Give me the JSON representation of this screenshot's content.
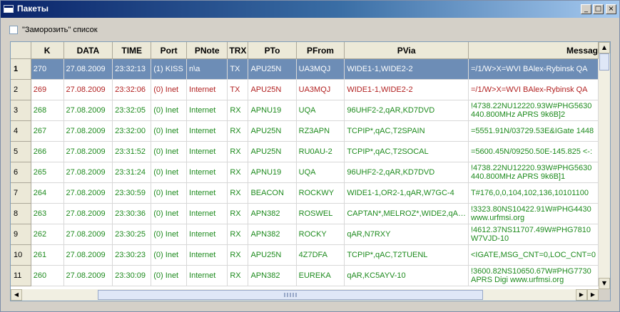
{
  "window": {
    "title": "Пакеты",
    "min_label": "_",
    "max_label": "□",
    "close_label": "×"
  },
  "freeze_checkbox": {
    "label": "\"Заморозить\" список",
    "checked": false
  },
  "colors": {
    "rx": "#1e8b1e",
    "tx_recent": "#b22222",
    "selected_bg": "#6d8db6",
    "selected_text": "#ffffff"
  },
  "table": {
    "columns": [
      "K",
      "DATA",
      "TIME",
      "Port",
      "PNote",
      "TRX",
      "PTo",
      "PFrom",
      "PVia",
      "Messag"
    ],
    "rows": [
      {
        "n": "1",
        "k": "270",
        "date": "27.08.2009",
        "time": "23:32:13",
        "port": "(1) KISS",
        "pnote": "n\\a",
        "trx": "TX",
        "pto": "APU25N",
        "pfrom": "UA3MQJ",
        "pvia": "WIDE1-1,WIDE2-2",
        "msg": "=/1/W>X=WVI  BAlex-Rybinsk QA",
        "color": "selected"
      },
      {
        "n": "2",
        "k": "269",
        "date": "27.08.2009",
        "time": "23:32:06",
        "port": "(0) Inet",
        "pnote": "Internet",
        "trx": "TX",
        "pto": "APU25N",
        "pfrom": "UA3MQJ",
        "pvia": "WIDE1-1,WIDE2-2",
        "msg": "=/1/W>X=WVI  BAlex-Rybinsk QA",
        "color": "tx"
      },
      {
        "n": "3",
        "k": "268",
        "date": "27.08.2009",
        "time": "23:32:05",
        "port": "(0) Inet",
        "pnote": "Internet",
        "trx": "RX",
        "pto": "APNU19",
        "pfrom": "UQA",
        "pvia": "96UHF2-2,qAR,KD7DVD",
        "msg": "!4738.22NU12220.93W#PHG5630 440.800MHz APRS 9k6B]2",
        "color": "rx"
      },
      {
        "n": "4",
        "k": "267",
        "date": "27.08.2009",
        "time": "23:32:00",
        "port": "(0) Inet",
        "pnote": "Internet",
        "trx": "RX",
        "pto": "APU25N",
        "pfrom": "RZ3APN",
        "pvia": "TCPIP*,qAC,T2SPAIN",
        "msg": "=5551.91N/03729.53E&IGate 1448",
        "color": "rx"
      },
      {
        "n": "5",
        "k": "266",
        "date": "27.08.2009",
        "time": "23:31:52",
        "port": "(0) Inet",
        "pnote": "Internet",
        "trx": "RX",
        "pto": "APU25N",
        "pfrom": "RU0AU-2",
        "pvia": "TCPIP*,qAC,T2SOCAL",
        "msg": "=5600.45N/09250.50E-145.825 <-:",
        "color": "rx"
      },
      {
        "n": "6",
        "k": "265",
        "date": "27.08.2009",
        "time": "23:31:24",
        "port": "(0) Inet",
        "pnote": "Internet",
        "trx": "RX",
        "pto": "APNU19",
        "pfrom": "UQA",
        "pvia": "96UHF2-2,qAR,KD7DVD",
        "msg": "!4738.22NU12220.93W#PHG5630 440.800MHz APRS 9k6B]1",
        "color": "rx"
      },
      {
        "n": "7",
        "k": "264",
        "date": "27.08.2009",
        "time": "23:30:59",
        "port": "(0) Inet",
        "pnote": "Internet",
        "trx": "RX",
        "pto": "BEACON",
        "pfrom": "ROCKWY",
        "pvia": "WIDE1-1,OR2-1,qAR,W7GC-4",
        "msg": "T#176,0,0,104,102,136,10101100",
        "color": "rx"
      },
      {
        "n": "8",
        "k": "263",
        "date": "27.08.2009",
        "time": "23:30:36",
        "port": "(0) Inet",
        "pnote": "Internet",
        "trx": "RX",
        "pto": "APN382",
        "pfrom": "ROSWEL",
        "pvia": "CAPTAN*,MELROZ*,WIDE2,qA…",
        "msg": "!3323.80NS10422.91W#PHG4430 www.urfmsi.org",
        "color": "rx"
      },
      {
        "n": "9",
        "k": "262",
        "date": "27.08.2009",
        "time": "23:30:25",
        "port": "(0) Inet",
        "pnote": "Internet",
        "trx": "RX",
        "pto": "APN382",
        "pfrom": "ROCKY",
        "pvia": "qAR,N7RXY",
        "msg": "!4612.37NS11707.49W#PHG7810 W7VJD-10",
        "color": "rx"
      },
      {
        "n": "10",
        "k": "261",
        "date": "27.08.2009",
        "time": "23:30:23",
        "port": "(0) Inet",
        "pnote": "Internet",
        "trx": "RX",
        "pto": "APU25N",
        "pfrom": "4Z7DFA",
        "pvia": "TCPIP*,qAC,T2TUENL",
        "msg": "<IGATE,MSG_CNT=0,LOC_CNT=0",
        "color": "rx"
      },
      {
        "n": "11",
        "k": "260",
        "date": "27.08.2009",
        "time": "23:30:09",
        "port": "(0) Inet",
        "pnote": "Internet",
        "trx": "RX",
        "pto": "APN382",
        "pfrom": "EUREKA",
        "pvia": "qAR,KC5AYV-10",
        "msg": "!3600.82NS10650.67W#PHG7730 APRS Digi www.urfmsi.org",
        "color": "rx"
      }
    ]
  },
  "scrollbars": {
    "up_glyph": "▲",
    "down_glyph": "▼",
    "left_glyph": "◀",
    "right_glyph": "▶",
    "vertical_position": 0.0,
    "horizontal_position": 0.45
  }
}
